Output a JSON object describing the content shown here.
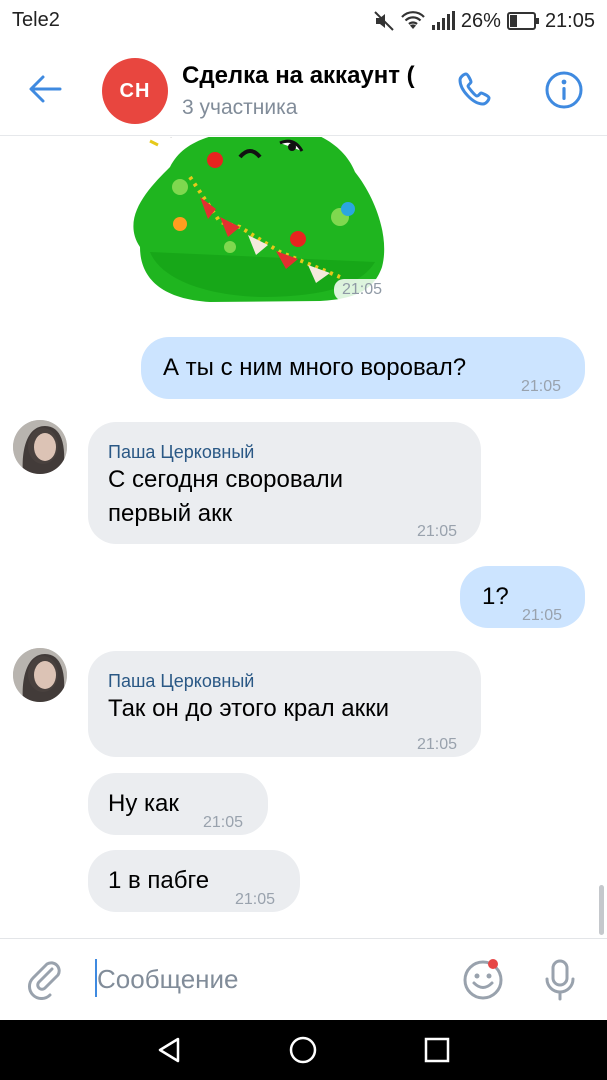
{
  "status_bar": {
    "carrier": "Tele2",
    "battery": "26%",
    "time": "21:05",
    "icons": [
      "mute-icon",
      "wifi-icon",
      "signal-icon",
      "battery-icon"
    ]
  },
  "header": {
    "avatar_initials": "СН",
    "title": "Сделка на аккаунт (",
    "subtitle": "3 участника",
    "accent_color": "#3f8ae0"
  },
  "messages": [
    {
      "type": "sticker",
      "direction": "incoming",
      "time": "21:05"
    },
    {
      "type": "text",
      "direction": "outgoing",
      "text": "А ты с ним много воровал?",
      "time": "21:05"
    },
    {
      "type": "text",
      "direction": "incoming",
      "sender": "Паша Церковный",
      "lines": [
        "С сегодня своровали",
        "первый акк"
      ],
      "time": "21:05"
    },
    {
      "type": "text",
      "direction": "outgoing",
      "text": "1?",
      "time": "21:05"
    },
    {
      "type": "text",
      "direction": "incoming",
      "sender": "Паша Церковный",
      "text": "Так он до этого крал акки",
      "time": "21:05"
    },
    {
      "type": "text",
      "direction": "incoming",
      "text": "Ну как",
      "time": "21:05"
    },
    {
      "type": "text",
      "direction": "incoming",
      "text": "1 в пабге",
      "time": "21:05"
    }
  ],
  "composer": {
    "placeholder": "Сообщение"
  },
  "colors": {
    "outgoing_bubble": "#cce4ff",
    "incoming_bubble": "#ebedf0",
    "sender_name": "#2a5885",
    "avatar_bg": "#e8463f"
  }
}
